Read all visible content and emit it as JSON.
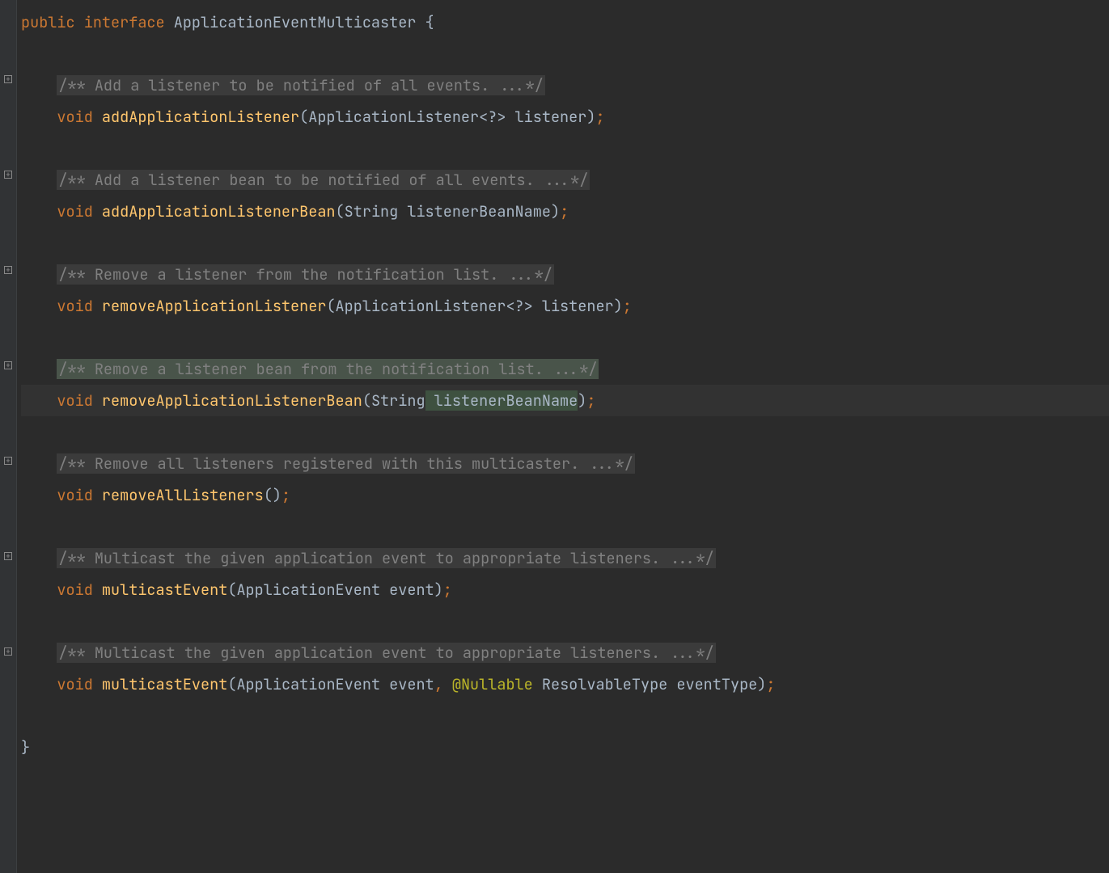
{
  "declaration": {
    "kw_public": "public",
    "kw_interface": "interface",
    "name": "ApplicationEventMulticaster",
    "brace_open": " {",
    "brace_close": "}"
  },
  "blocks": [
    {
      "doc_open": "/**",
      "doc_text": " Add a listener to be notified of all events. ",
      "doc_ellipsis": "...",
      "doc_close": "*/",
      "kw_void": "void",
      "method": "addApplicationListener",
      "sig_pre": "(",
      "ptype": "ApplicationListener<?>",
      "pname": " listener",
      "sig_post": ")",
      "semi": ";"
    },
    {
      "doc_open": "/**",
      "doc_text": " Add a listener bean to be notified of all events. ",
      "doc_ellipsis": "...",
      "doc_close": "*/",
      "kw_void": "void",
      "method": "addApplicationListenerBean",
      "sig_pre": "(",
      "ptype": "String",
      "pname": " listenerBeanName",
      "sig_post": ")",
      "semi": ";"
    },
    {
      "doc_open": "/**",
      "doc_text": " Remove a listener from the notification list. ",
      "doc_ellipsis": "...",
      "doc_close": "*/",
      "kw_void": "void",
      "method": "removeApplicationListener",
      "sig_pre": "(",
      "ptype": "ApplicationListener<?>",
      "pname": " listener",
      "sig_post": ")",
      "semi": ";"
    },
    {
      "doc_open": "/**",
      "doc_text": " Remove a listener bean from the notification list. ",
      "doc_ellipsis": "...",
      "doc_close": "*/",
      "kw_void": "void",
      "method": "removeApplicationListenerBean",
      "sig_pre": "(",
      "ptype": "String",
      "pname": " listenerBeanName",
      "sig_post": ")",
      "semi": ";",
      "highlight": true
    },
    {
      "doc_open": "/**",
      "doc_text": " Remove all listeners registered with this multicaster. ",
      "doc_ellipsis": "...",
      "doc_close": "*/",
      "kw_void": "void",
      "method": "removeAllListeners",
      "sig_pre": "(",
      "ptype": "",
      "pname": "",
      "sig_post": ")",
      "semi": ";"
    },
    {
      "doc_open": "/**",
      "doc_text": " Multicast the given application event to appropriate listeners. ",
      "doc_ellipsis": "...",
      "doc_close": "*/",
      "kw_void": "void",
      "method": "multicastEvent",
      "sig_pre": "(",
      "ptype": "ApplicationEvent",
      "pname": " event",
      "sig_post": ")",
      "semi": ";"
    },
    {
      "doc_open": "/**",
      "doc_text": " Multicast the given application event to appropriate listeners. ",
      "doc_ellipsis": "...",
      "doc_close": "*/",
      "kw_void": "void",
      "method": "multicastEvent",
      "sig_pre": "(",
      "ptype": "ApplicationEvent",
      "pname": " event",
      "comma": ", ",
      "ann": "@Nullable",
      "ptype2": " ResolvableType",
      "pname2": " eventType",
      "sig_post": ")",
      "semi": ";",
      "extended": true
    }
  ],
  "colors": {
    "bg": "#2b2b2b",
    "gutter": "#313335",
    "keyword": "#cc7832",
    "method": "#ffc66d",
    "annotation": "#bbb529",
    "doc_bg": "#3b3b3b",
    "doc_fg": "#808080"
  }
}
